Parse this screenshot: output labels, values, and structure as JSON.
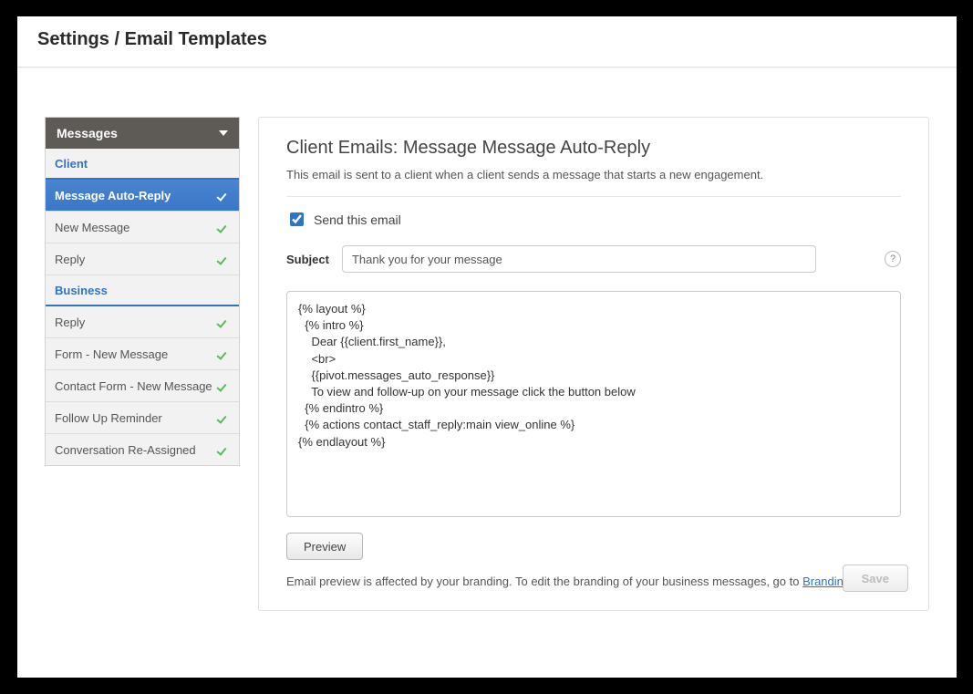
{
  "header": {
    "title": "Settings / Email Templates"
  },
  "sidebar": {
    "title": "Messages",
    "section_client": "Client",
    "section_business": "Business",
    "client_items": [
      {
        "label": "Message Auto-Reply",
        "active": true
      },
      {
        "label": "New Message"
      },
      {
        "label": "Reply"
      }
    ],
    "business_items": [
      {
        "label": "Reply"
      },
      {
        "label": "Form - New Message"
      },
      {
        "label": "Contact Form - New Message"
      },
      {
        "label": "Follow Up Reminder"
      },
      {
        "label": "Conversation Re-Assigned"
      }
    ]
  },
  "main": {
    "heading": "Client Emails: Message Message Auto-Reply",
    "description": "This email is sent to a client when a client sends a message that starts a new engagement.",
    "send_checkbox_label": "Send this email",
    "send_checked": true,
    "subject_label": "Subject",
    "subject_value": "Thank you for your message",
    "help_char": "?",
    "body_value": "{% layout %}\n  {% intro %}\n    Dear {{client.first_name}},\n    <br>\n    {{pivot.messages_auto_response}}\n    To view and follow-up on your message click the button below\n  {% endintro %}\n  {% actions contact_staff_reply:main view_online %}\n{% endlayout %}",
    "preview_button": "Preview",
    "branding_note_prefix": "Email preview is affected by your branding. To edit the branding of your business messages, go to ",
    "branding_link": "Branding Settings",
    "save_button": "Save"
  }
}
